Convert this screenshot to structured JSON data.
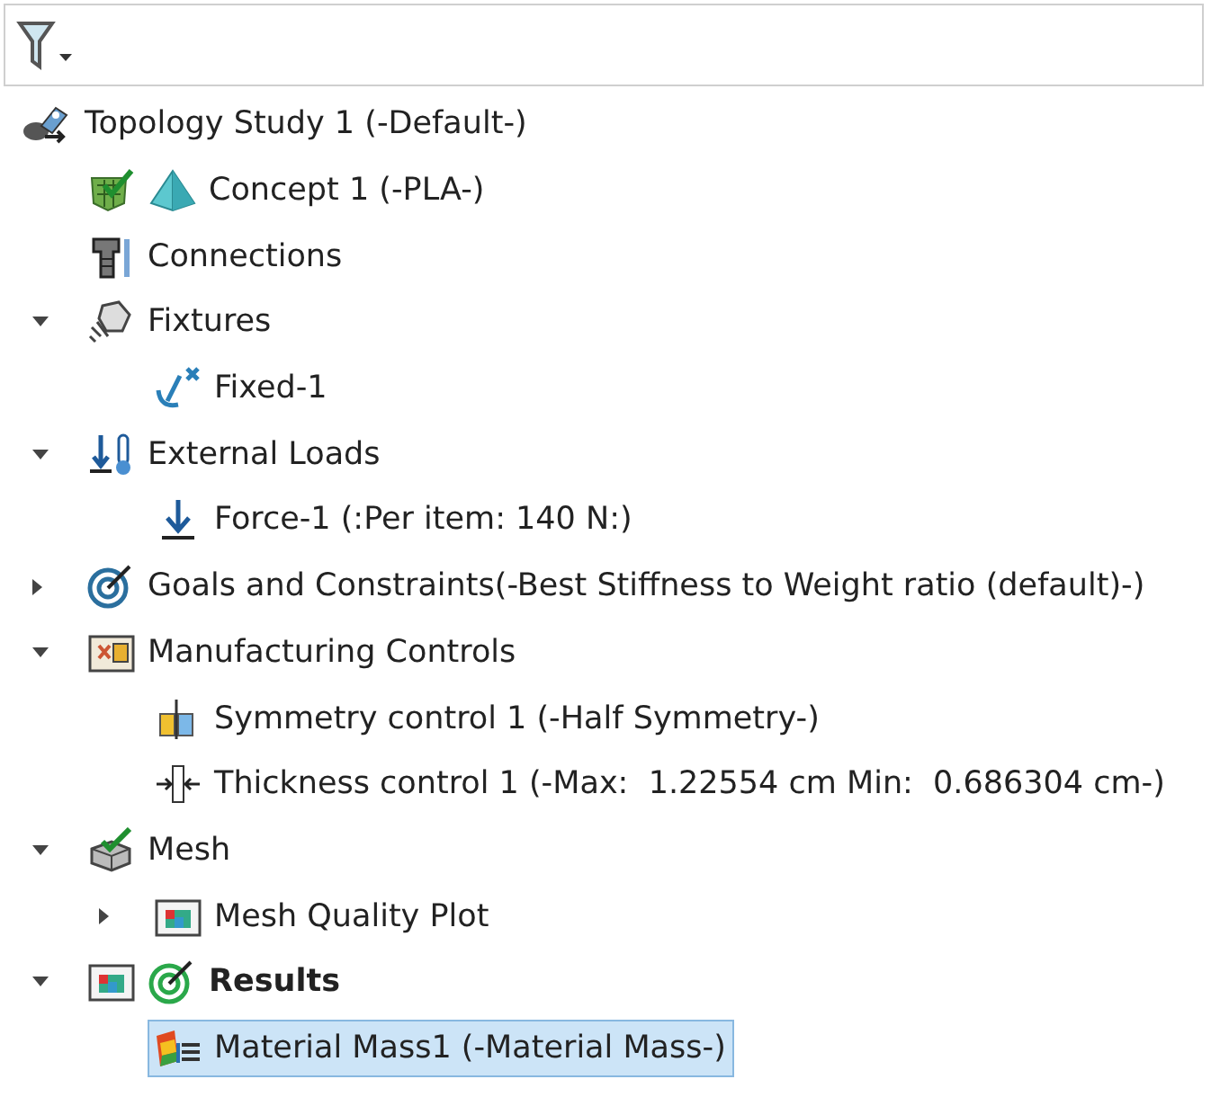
{
  "tree": {
    "label": "Topology Study 1 (-Default-)",
    "selected": false,
    "children": [
      {
        "label": "Concept 1 (-PLA-)",
        "selected": false
      },
      {
        "label": "Connections",
        "selected": false
      },
      {
        "label": "Fixtures",
        "expanded": true,
        "selected": false,
        "children": [
          {
            "label": "Fixed-1",
            "selected": false
          }
        ]
      },
      {
        "label": "External Loads",
        "expanded": true,
        "selected": false,
        "children": [
          {
            "label": "Force-1 (:Per item: 140 N:)",
            "selected": false
          }
        ]
      },
      {
        "label": "Goals and Constraints(-Best Stiffness to Weight ratio (default)-)",
        "expanded": false,
        "selected": false
      },
      {
        "label": "Manufacturing Controls",
        "expanded": true,
        "selected": false,
        "children": [
          {
            "label": "Symmetry control 1 (-Half Symmetry-)",
            "selected": false
          },
          {
            "label": "Thickness control 1 (-Max:  1.22554 cm Min:  0.686304 cm-)",
            "selected": false
          }
        ]
      },
      {
        "label": "Mesh",
        "expanded": true,
        "selected": false,
        "children": [
          {
            "label": "Mesh Quality Plot",
            "expanded": false,
            "selected": false
          }
        ]
      },
      {
        "label": "Results",
        "expanded": true,
        "selected": false,
        "bold": true,
        "children": [
          {
            "label": "Material Mass1 (-Material Mass-)",
            "selected": true
          }
        ]
      }
    ]
  }
}
